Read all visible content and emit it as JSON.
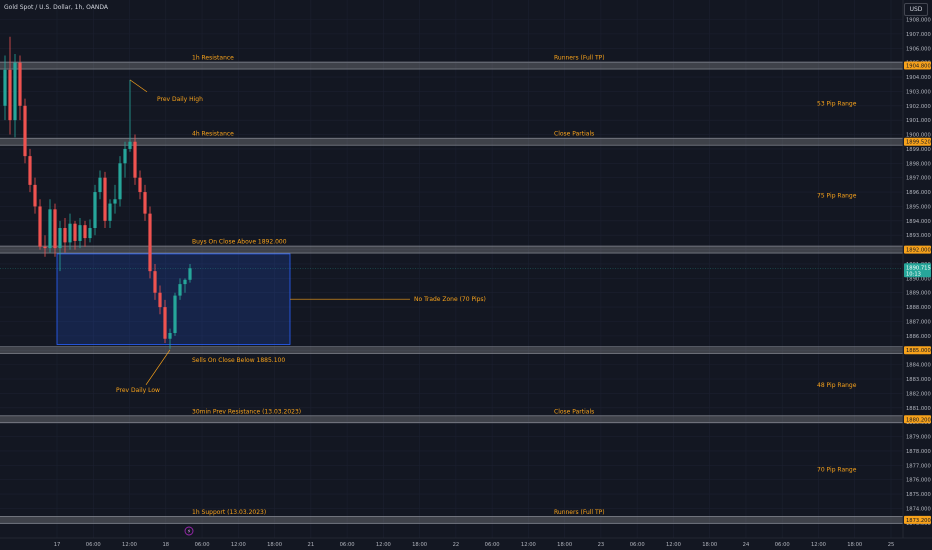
{
  "header": {
    "symbol": "Gold Spot / U.S. Dollar, 1h, OANDA",
    "currency": "USD"
  },
  "price_axis": {
    "labels": [
      "1908.000",
      "1907.000",
      "1906.000",
      "1905.000",
      "1904.000",
      "1903.000",
      "1902.000",
      "1901.000",
      "1900.000",
      "1899.000",
      "1898.000",
      "1897.000",
      "1896.000",
      "1895.000",
      "1894.000",
      "1893.000",
      "1892.000",
      "1891.000",
      "1890.000",
      "1889.000",
      "1888.000",
      "1887.000",
      "1886.000",
      "1885.000",
      "1884.000",
      "1883.000",
      "1882.000",
      "1881.000",
      "1880.000",
      "1879.000",
      "1878.000",
      "1877.000",
      "1876.000",
      "1875.000",
      "1874.000",
      "1873.000"
    ],
    "badges": [
      {
        "text": "1904.800",
        "value": 1904.8,
        "color": "#f7a21b",
        "text_color": "#131722"
      },
      {
        "text": "1899.520",
        "value": 1899.5,
        "color": "#f7a21b",
        "text_color": "#131722"
      },
      {
        "text": "1892.000",
        "value": 1892.0,
        "color": "#f7a21b",
        "text_color": "#131722"
      },
      {
        "text": "1885.000",
        "value": 1885.0,
        "color": "#f7a21b",
        "text_color": "#131722"
      },
      {
        "text": "1880.200",
        "value": 1880.2,
        "color": "#f7a21b",
        "text_color": "#131722"
      },
      {
        "text": "1873.200",
        "value": 1873.2,
        "color": "#f7a21b",
        "text_color": "#131722"
      }
    ],
    "current": {
      "price": "1890.715",
      "countdown": "10:13",
      "value": 1890.7,
      "color": "#26a69a"
    }
  },
  "time_axis": {
    "labels": [
      "17",
      "06:00",
      "12:00",
      "18",
      "06:00",
      "12:00",
      "18:00",
      "21",
      "06:00",
      "12:00",
      "18:00",
      "22",
      "06:00",
      "12:00",
      "18:00",
      "23",
      "06:00",
      "12:00",
      "18:00",
      "24",
      "06:00",
      "12:00",
      "18:00",
      "25"
    ]
  },
  "chart_data": {
    "type": "candlestick",
    "symbol": "Gold Spot / U.S. Dollar",
    "timeframe": "1h",
    "source": "OANDA",
    "ylim": [
      1872.5,
      1908.8
    ],
    "grid": true,
    "colors": {
      "up": "#26a69a",
      "down": "#ef5350",
      "level": "#f7a21b",
      "zone": "#2962ff"
    },
    "candles": [
      {
        "o": 1902.0,
        "h": 1905.5,
        "l": 1901.0,
        "c": 1904.5
      },
      {
        "o": 1904.5,
        "h": 1906.8,
        "l": 1900.0,
        "c": 1901.0
      },
      {
        "o": 1901.0,
        "h": 1905.6,
        "l": 1899.8,
        "c": 1905.0
      },
      {
        "o": 1905.0,
        "h": 1905.5,
        "l": 1901.0,
        "c": 1902.0
      },
      {
        "o": 1902.0,
        "h": 1902.5,
        "l": 1898.0,
        "c": 1898.5
      },
      {
        "o": 1898.5,
        "h": 1899.0,
        "l": 1896.0,
        "c": 1896.5
      },
      {
        "o": 1896.5,
        "h": 1897.0,
        "l": 1894.5,
        "c": 1895.0
      },
      {
        "o": 1895.0,
        "h": 1895.5,
        "l": 1892.0,
        "c": 1892.2
      },
      {
        "o": 1892.2,
        "h": 1893.0,
        "l": 1891.5,
        "c": 1892.1
      },
      {
        "o": 1892.1,
        "h": 1895.5,
        "l": 1891.8,
        "c": 1894.8
      },
      {
        "o": 1894.8,
        "h": 1895.2,
        "l": 1891.5,
        "c": 1892.1
      },
      {
        "o": 1892.1,
        "h": 1894.0,
        "l": 1890.5,
        "c": 1893.5
      },
      {
        "o": 1893.5,
        "h": 1894.2,
        "l": 1891.8,
        "c": 1892.5
      },
      {
        "o": 1892.5,
        "h": 1894.5,
        "l": 1892.0,
        "c": 1893.8
      },
      {
        "o": 1893.8,
        "h": 1894.0,
        "l": 1892.0,
        "c": 1892.6
      },
      {
        "o": 1892.6,
        "h": 1894.2,
        "l": 1892.1,
        "c": 1893.7
      },
      {
        "o": 1893.7,
        "h": 1894.0,
        "l": 1892.2,
        "c": 1892.8
      },
      {
        "o": 1892.8,
        "h": 1894.1,
        "l": 1892.5,
        "c": 1893.5
      },
      {
        "o": 1893.5,
        "h": 1896.5,
        "l": 1893.0,
        "c": 1896.0
      },
      {
        "o": 1896.0,
        "h": 1897.5,
        "l": 1895.5,
        "c": 1897.0
      },
      {
        "o": 1897.0,
        "h": 1897.4,
        "l": 1893.5,
        "c": 1894.0
      },
      {
        "o": 1894.0,
        "h": 1895.5,
        "l": 1893.5,
        "c": 1895.2
      },
      {
        "o": 1895.2,
        "h": 1896.5,
        "l": 1894.5,
        "c": 1895.5
      },
      {
        "o": 1895.5,
        "h": 1898.5,
        "l": 1895.0,
        "c": 1898.0
      },
      {
        "o": 1898.0,
        "h": 1899.5,
        "l": 1897.0,
        "c": 1899.0
      },
      {
        "o": 1899.0,
        "h": 1903.8,
        "l": 1898.8,
        "c": 1899.5
      },
      {
        "o": 1899.5,
        "h": 1900.0,
        "l": 1896.5,
        "c": 1897.0
      },
      {
        "o": 1897.0,
        "h": 1897.5,
        "l": 1895.5,
        "c": 1896.0
      },
      {
        "o": 1896.0,
        "h": 1896.5,
        "l": 1894.0,
        "c": 1894.5
      },
      {
        "o": 1894.5,
        "h": 1895.0,
        "l": 1890.0,
        "c": 1890.5
      },
      {
        "o": 1890.5,
        "h": 1891.0,
        "l": 1888.5,
        "c": 1889.0
      },
      {
        "o": 1889.0,
        "h": 1889.5,
        "l": 1887.5,
        "c": 1888.0
      },
      {
        "o": 1888.0,
        "h": 1888.5,
        "l": 1885.5,
        "c": 1885.8
      },
      {
        "o": 1885.8,
        "h": 1886.5,
        "l": 1885.1,
        "c": 1886.2
      },
      {
        "o": 1886.2,
        "h": 1889.0,
        "l": 1886.0,
        "c": 1888.8
      },
      {
        "o": 1888.8,
        "h": 1890.0,
        "l": 1888.5,
        "c": 1889.6
      },
      {
        "o": 1889.6,
        "h": 1890.0,
        "l": 1889.0,
        "c": 1889.9
      },
      {
        "o": 1889.9,
        "h": 1891.0,
        "l": 1889.7,
        "c": 1890.7
      }
    ],
    "levels": [
      {
        "price": 1904.8,
        "label": "1h Resistance",
        "right_label": "Runners (Full TP)"
      },
      {
        "price": 1899.5,
        "label": "4h Resistance",
        "right_label": "Close Partials"
      },
      {
        "price": 1892.0,
        "label": "Buys On Close Above 1892.000",
        "right_label": ""
      },
      {
        "price": 1885.0,
        "label": "Sells On Close Below 1885.100",
        "right_label": ""
      },
      {
        "price": 1880.2,
        "label": "30min Prev Resistance (13.03.2023)",
        "right_label": "Close Partials"
      },
      {
        "price": 1873.2,
        "label": "1h Support (13.03.2023)",
        "right_label": "Runners (Full TP)"
      }
    ],
    "ranges": [
      {
        "from": 1904.8,
        "to": 1899.5,
        "label": "53 Pip Range"
      },
      {
        "from": 1899.5,
        "to": 1892.0,
        "label": "75 Pip Range"
      },
      {
        "from": 1885.0,
        "to": 1880.2,
        "label": "48 Pip Range"
      },
      {
        "from": 1880.2,
        "to": 1873.2,
        "label": "70 Pip Range"
      }
    ],
    "zone": {
      "top": 1891.7,
      "bottom": 1885.4,
      "label": "No Trade Zone (70 Pips)"
    },
    "annotations": [
      {
        "label": "Prev Daily High",
        "price": 1903.8
      },
      {
        "label": "Prev Daily Low",
        "price": 1885.1
      }
    ],
    "last_price": 1890.7
  }
}
